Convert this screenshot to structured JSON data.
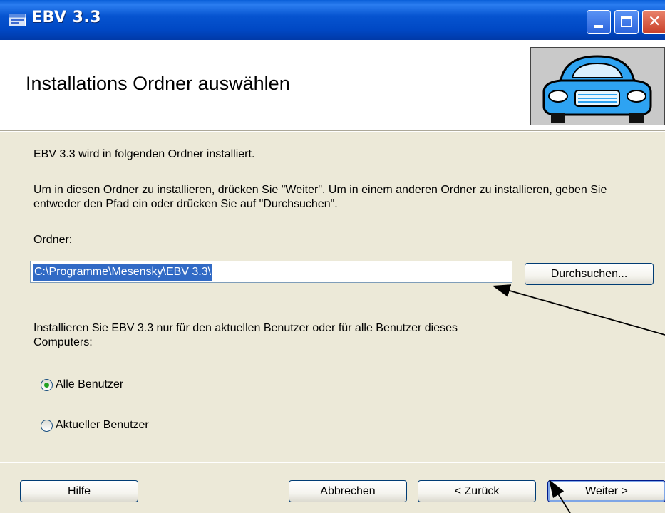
{
  "window": {
    "title": "EBV 3.3",
    "title_icon": "app-window-icon",
    "controls": {
      "minimize": "minimize-icon",
      "maximize": "maximize-icon",
      "close": "close-icon"
    }
  },
  "header": {
    "title": "Installations Ordner auswählen",
    "graphic_icon": "car-icon"
  },
  "body": {
    "info": "EBV 3.3  wird in folgenden Ordner installiert.",
    "instructions": "Um in diesen Ordner zu installieren, drücken Sie \"Weiter\".  Um in einem anderen Ordner zu installieren, geben Sie entweder den Pfad ein oder drücken Sie auf \"Durchsuchen\".",
    "folder_label": "Ordner:",
    "folder_path": "C:\\Programme\\Mesensky\\EBV 3.3\\",
    "browse_label": "Durchsuchen...",
    "users_prompt": "Installieren Sie EBV 3.3  nur für den aktuellen Benutzer oder für alle Benutzer dieses Computers:",
    "options": [
      {
        "label": "Alle Benutzer",
        "checked": true
      },
      {
        "label": "Aktueller Benutzer",
        "checked": false
      }
    ]
  },
  "footer": {
    "help": "Hilfe",
    "cancel": "Abbrechen",
    "back": "< Zurück",
    "next": "Weiter >"
  },
  "colors": {
    "titlebar": "#0054e3",
    "face": "#ece9d8",
    "selection": "#316ac5",
    "radio_dot": "#21a121"
  }
}
